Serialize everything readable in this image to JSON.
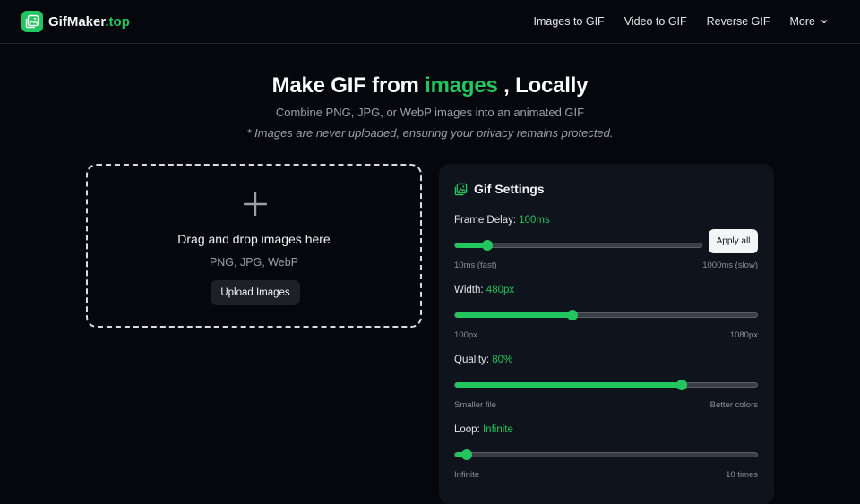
{
  "header": {
    "brand_main": "GifMaker",
    "brand_accent": ".top",
    "nav": [
      "Images to GIF",
      "Video to GIF",
      "Reverse GIF"
    ],
    "more_label": "More"
  },
  "hero": {
    "title_before": "Make GIF from ",
    "title_accent": "images",
    "title_after": " , Locally",
    "subtitle": "Combine PNG, JPG, or WebP images into an animated GIF",
    "note": "* Images are never uploaded, ensuring your privacy remains protected."
  },
  "dropzone": {
    "title": "Drag and drop images here",
    "formats": "PNG, JPG, WebP",
    "upload_label": "Upload Images"
  },
  "settings": {
    "title": "Gif Settings",
    "frame_delay": {
      "label": "Frame Delay:",
      "value": "100ms",
      "min_label": "10ms (fast)",
      "max_label": "1000ms (slow)",
      "percent": 13,
      "apply_label": "Apply all"
    },
    "width": {
      "label": "Width:",
      "value": "480px",
      "min_label": "100px",
      "max_label": "1080px",
      "percent": 39
    },
    "quality": {
      "label": "Quality:",
      "value": "80%",
      "min_label": "Smaller file",
      "max_label": "Better colors",
      "percent": 75
    },
    "loop": {
      "label": "Loop:",
      "value": "Infinite",
      "min_label": "Infinite",
      "max_label": "10 times",
      "percent": 4
    }
  },
  "colors": {
    "accent": "#22c55e",
    "background": "#05070d",
    "panel": "#0f131b"
  }
}
